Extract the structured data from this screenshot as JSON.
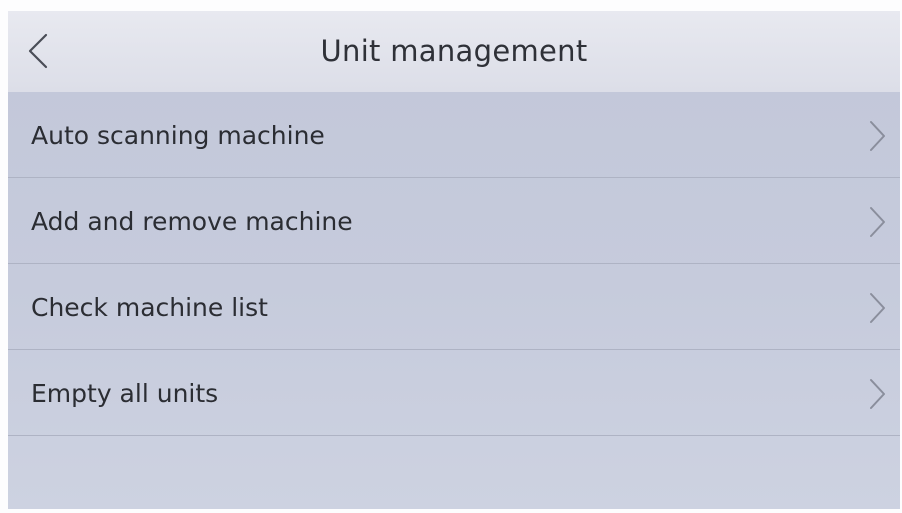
{
  "header": {
    "title": "Unit management",
    "back_icon": "chevron-left-icon"
  },
  "menu": {
    "items": [
      {
        "label": "Auto scanning machine",
        "icon": "chevron-right-icon"
      },
      {
        "label": "Add and remove machine",
        "icon": "chevron-right-icon"
      },
      {
        "label": "Check machine list",
        "icon": "chevron-right-icon"
      },
      {
        "label": "Empty all units",
        "icon": "chevron-right-icon"
      }
    ]
  },
  "colors": {
    "header_bg": "#e2e4ec",
    "list_bg": "#c4c9da",
    "divider": "#aeb3c4",
    "text": "#2b2d33",
    "chevron": "#8a8e9c"
  }
}
